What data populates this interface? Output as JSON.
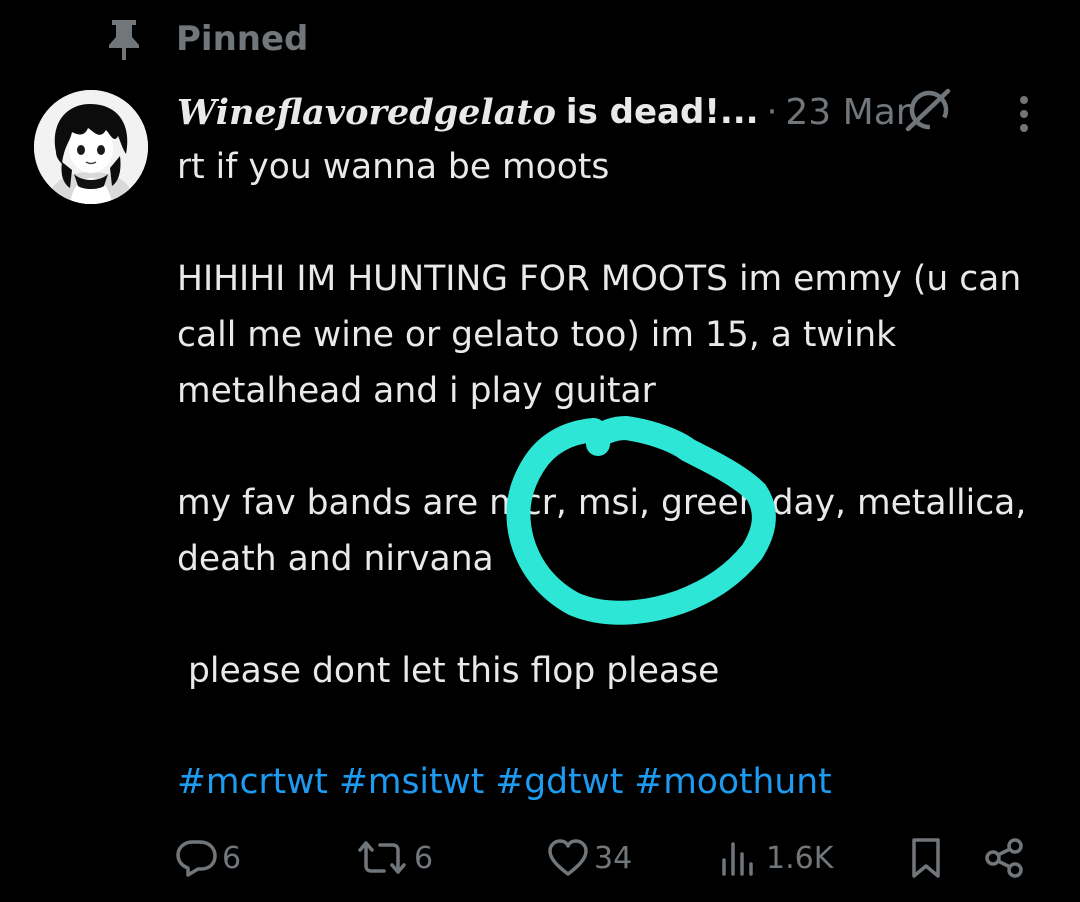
{
  "pinned": {
    "label": "Pinned"
  },
  "post": {
    "display_name": "Wineflavoredgelato",
    "name_suffix": "is dead!...",
    "separator": "·",
    "date": "23 Mar",
    "text_lines": [
      "rt if you wanna be moots",
      "",
      "HIHIHI IM HUNTING FOR MOOTS im emmy (u can call me wine or gelato too) im 15, a twink metalhead and i play guitar",
      "",
      "my fav bands are mcr, msi, green day, metallica, death and nirvana",
      "",
      " please dont let this flop please",
      ""
    ],
    "hashtags": [
      "#mcrtwt",
      "#msitwt",
      "#gdtwt",
      "#moothunt"
    ]
  },
  "actions": {
    "replies": "6",
    "reposts": "6",
    "likes": "34",
    "views": "1.6K"
  },
  "icons": {
    "pin": "pin-icon",
    "grok": "grok-icon",
    "more": "more-vertical-icon",
    "reply": "reply-icon",
    "repost": "repost-icon",
    "like": "heart-icon",
    "views": "views-icon",
    "bookmark": "bookmark-icon",
    "share": "share-icon"
  },
  "colors": {
    "background": "#000000",
    "text": "#e7e9ea",
    "muted": "#71767b",
    "link": "#1d9bf0",
    "scribble": "#2ee6d6"
  }
}
